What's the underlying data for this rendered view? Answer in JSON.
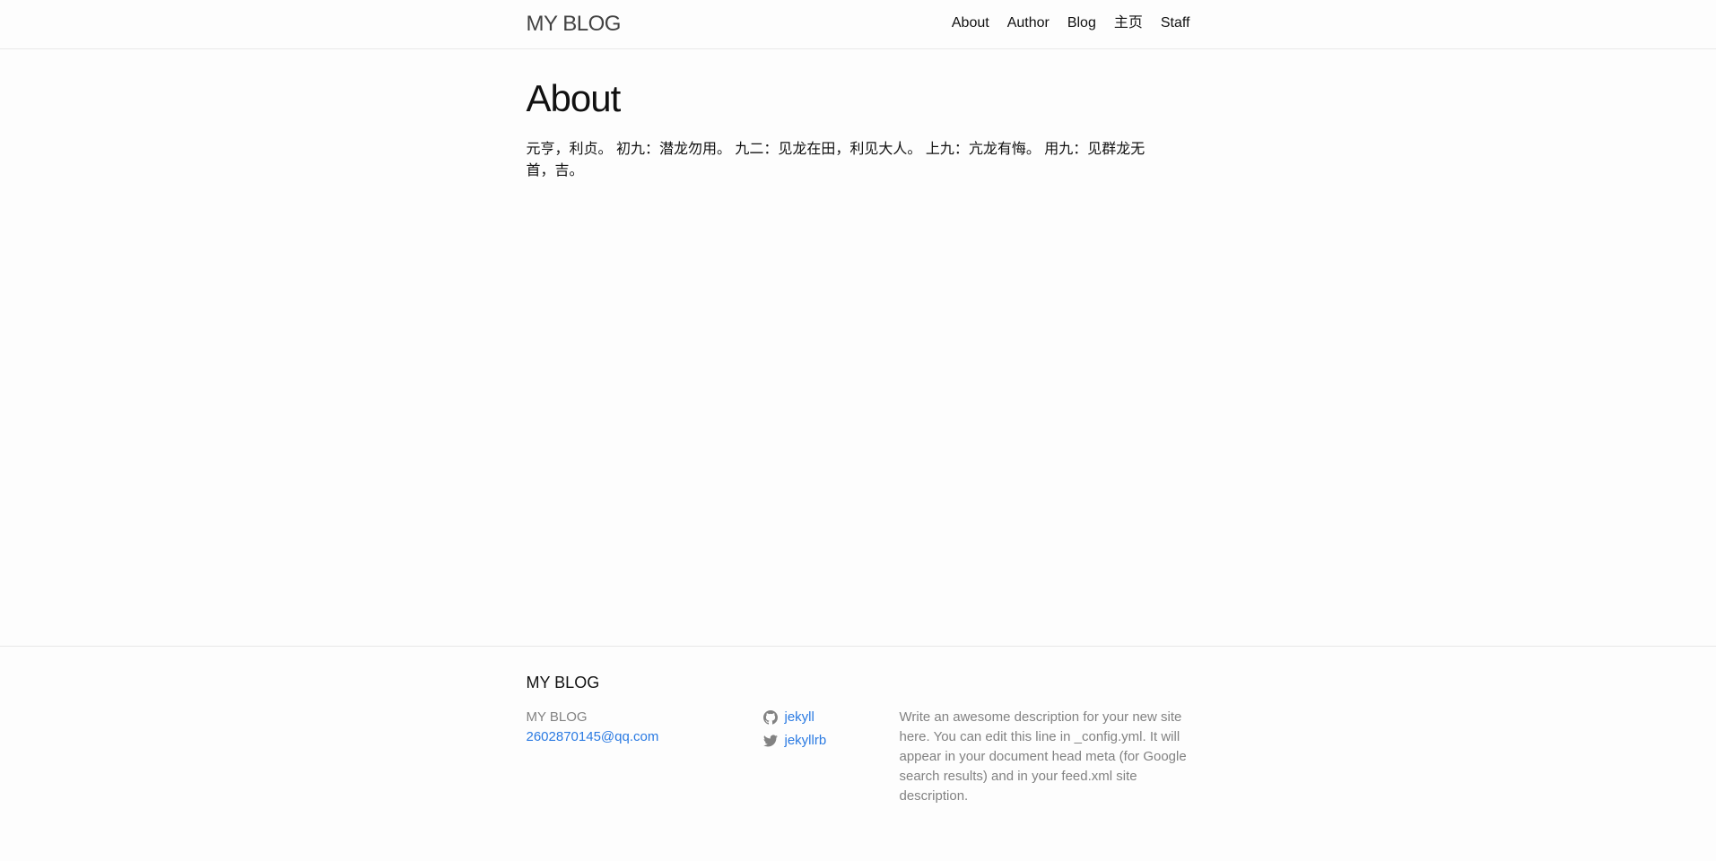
{
  "header": {
    "site_title": "MY BLOG",
    "nav": [
      {
        "label": "About"
      },
      {
        "label": "Author"
      },
      {
        "label": "Blog"
      },
      {
        "label": "主页"
      },
      {
        "label": "Staff"
      }
    ]
  },
  "main": {
    "title": "About",
    "content": "元亨，利贞。 初九：潜龙勿用。 九二：见龙在田，利见大人。 上九：亢龙有悔。 用九：见群龙无首，吉。"
  },
  "footer": {
    "heading": "MY BLOG",
    "contact_name": "MY BLOG",
    "email": "2602870145@qq.com",
    "social": [
      {
        "icon": "github-icon",
        "label": "jekyll"
      },
      {
        "icon": "twitter-icon",
        "label": "jekyllrb"
      }
    ],
    "description": "Write an awesome description for your new site here. You can edit this line in _config.yml. It will appear in your document head meta (for Google search results) and in your feed.xml site description.",
    "colors": {
      "link": "#2a7ae2",
      "muted": "#828282"
    }
  }
}
